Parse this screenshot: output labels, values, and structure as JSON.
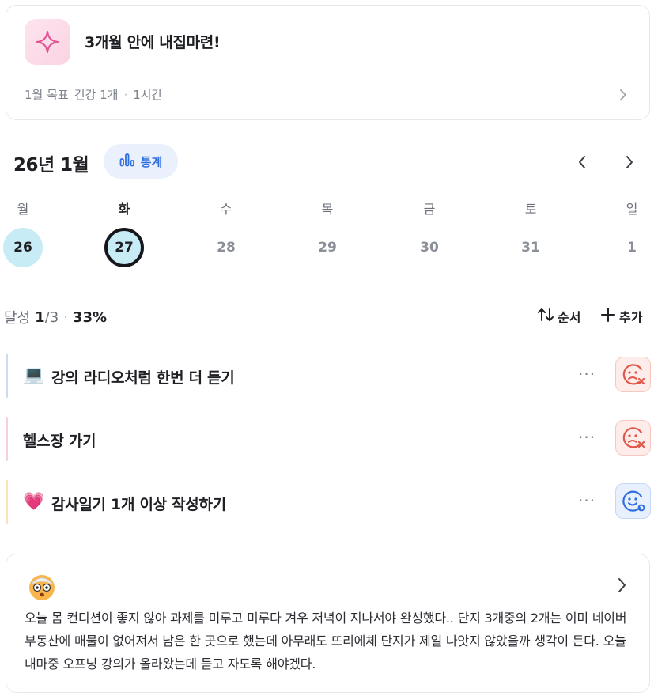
{
  "goal": {
    "icon": "sparkle-icon",
    "title": "3개월 안에 내집마련!",
    "meta_period": "1월 목표",
    "meta_category": "건강 1개",
    "meta_time": "1시간"
  },
  "calendar": {
    "month_label": "26년 1월",
    "stats_label": "통계",
    "weekdays": [
      "월",
      "화",
      "수",
      "목",
      "금",
      "토",
      "일"
    ],
    "days": [
      "26",
      "27",
      "28",
      "29",
      "30",
      "31",
      "1"
    ]
  },
  "progress": {
    "label": "달성",
    "done": "1",
    "total": "/3",
    "percent": "33%",
    "sort_label": "순서",
    "add_label": "추가"
  },
  "tasks": [
    {
      "emoji": "💻",
      "label": "강의 라디오처럼 한번 더 듣기",
      "status": "fail",
      "accent": "#cfd9f3"
    },
    {
      "emoji": "",
      "label": "헬스장 가기",
      "status": "fail",
      "accent": "#f6cfe0"
    },
    {
      "emoji": "💗",
      "label": "감사일기 1개 이상 작성하기",
      "status": "ok",
      "accent": "#fbe3b8"
    }
  ],
  "diary": {
    "mood_icon": "dizzy-face-icon",
    "text": "오늘 몸 컨디션이 좋지 않아 과제를 미루고 미루다 겨우 저녁이 지나서야 완성했다.. 단지 3개중의 2개는 이미 네이버 부동산에 매물이 없어져서 남은 한 곳으로 했는데 아무래도 뜨리에체 단지가 제일 나앗지 않았을까 생각이 든다. 오늘 내마중 오프닝 강의가 올라왔는데 듣고 자도록 해야겠다."
  },
  "more_label": "···",
  "colors": {
    "accent_blue": "#2f6fe0",
    "done_day": "#c8ecf5",
    "fail_red": "#e0574a"
  }
}
